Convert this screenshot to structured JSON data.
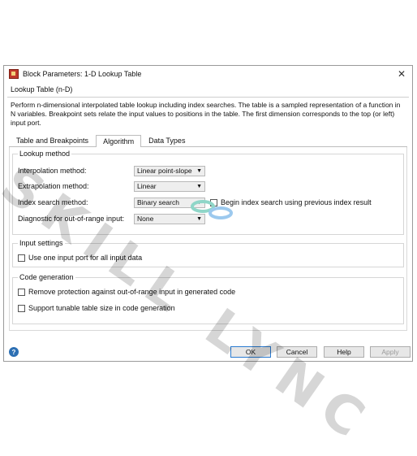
{
  "window": {
    "title": "Block Parameters: 1-D Lookup Table",
    "close_glyph": "✕"
  },
  "block": {
    "type_label": "Lookup Table (n-D)",
    "description": "Perform n-dimensional interpolated table lookup including index searches. The table is a sampled representation of a function in N variables. Breakpoint sets relate the input values to positions in the table. The first dimension corresponds to the top (or left) input port."
  },
  "tabs": [
    {
      "label": "Table and Breakpoints",
      "active": false
    },
    {
      "label": "Algorithm",
      "active": true
    },
    {
      "label": "Data Types",
      "active": false
    }
  ],
  "lookup_method": {
    "title": "Lookup method",
    "interpolation": {
      "label": "Interpolation method:",
      "value": "Linear point-slope"
    },
    "extrapolation": {
      "label": "Extrapolation method:",
      "value": "Linear"
    },
    "index_search": {
      "label": "Index search method:",
      "value": "Binary search"
    },
    "begin_index": {
      "label": "Begin index search using previous index result",
      "checked": false
    },
    "diagnostic": {
      "label": "Diagnostic for out-of-range input:",
      "value": "None"
    }
  },
  "input_settings": {
    "title": "Input settings",
    "one_input_port": {
      "label": "Use one input port for all input data",
      "checked": false
    }
  },
  "code_generation": {
    "title": "Code generation",
    "remove_protection": {
      "label": "Remove protection against out-of-range input in generated code",
      "checked": false
    },
    "tunable_size": {
      "label": "Support tunable table size in code generation",
      "checked": false
    }
  },
  "footer": {
    "ok": "OK",
    "cancel": "Cancel",
    "help": "Help",
    "apply": "Apply",
    "help_icon_glyph": "?"
  },
  "watermark": {
    "text": "SKILL LYNC"
  },
  "icons": {
    "dropdown_arrow": "▼"
  },
  "colors": {
    "accent": "#2a7bd1",
    "help_icon": "#2c6fb3"
  }
}
